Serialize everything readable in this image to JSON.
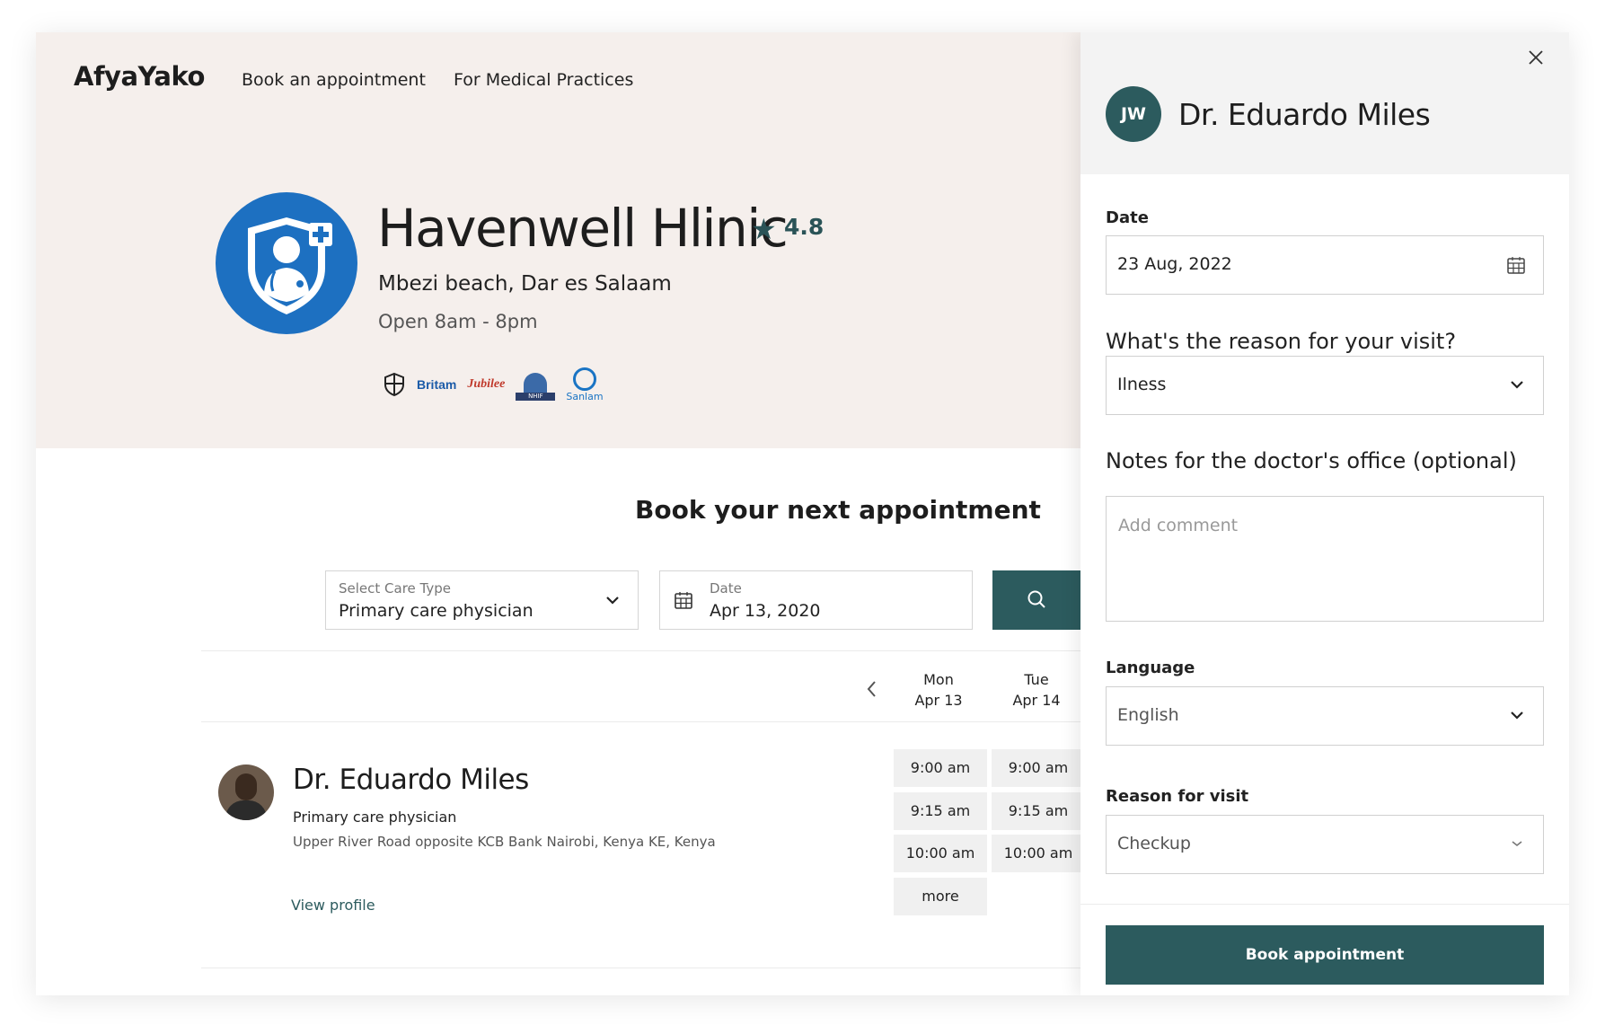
{
  "app": {
    "logo": "AfyaYako"
  },
  "nav": {
    "book": "Book an appointment",
    "practices": "For Medical Practices"
  },
  "clinic": {
    "name": "Havenwell Hlinic",
    "rating": "4.8",
    "address": "Mbezi beach, Dar es Salaam",
    "hours": "Open 8am - 8pm"
  },
  "insurers": {
    "britam": "Britam",
    "jubilee": "Jubilee",
    "nhif": "NHIF",
    "sanlam": "Sanlam"
  },
  "booking": {
    "title": "Book your next appointment",
    "care_label": "Select Care Type",
    "care_value": "Primary care physician",
    "date_label": "Date",
    "date_value": "Apr 13, 2020"
  },
  "days": [
    {
      "name": "Mon",
      "date": "Apr 13"
    },
    {
      "name": "Tue",
      "date": "Apr 14"
    }
  ],
  "doctor": {
    "name": "Dr. Eduardo Miles",
    "specialty": "Primary care physician",
    "address": "Upper River Road opposite KCB Bank Nairobi, Kenya KE, Kenya",
    "view_profile": "View profile"
  },
  "slots": {
    "mon": [
      "9:00 am",
      "9:15 am",
      "10:00 am",
      "more"
    ],
    "tue": [
      "9:00 am",
      "9:15 am",
      "10:00 am"
    ]
  },
  "panel": {
    "initials": "JW",
    "doctor_name": "Dr. Eduardo Miles",
    "date_label": "Date",
    "date_value": "23 Aug, 2022",
    "reason_question": "What's the reason for your visit?",
    "reason_value": "Ilness",
    "notes_question": "Notes for the doctor's office (optional)",
    "notes_placeholder": "Add comment",
    "language_label": "Language",
    "language_value": "English",
    "visit_label": "Reason for visit",
    "visit_value": "Checkup",
    "book_button": "Book appointment"
  },
  "colors": {
    "primary": "#2c5b5e",
    "hero_bg": "#f5efec",
    "clinic_logo": "#1d70c1"
  },
  "icons": [
    "star-icon",
    "shield-icon",
    "calendar-icon",
    "chevron-down-icon",
    "search-icon",
    "chevron-left-icon",
    "close-icon"
  ]
}
